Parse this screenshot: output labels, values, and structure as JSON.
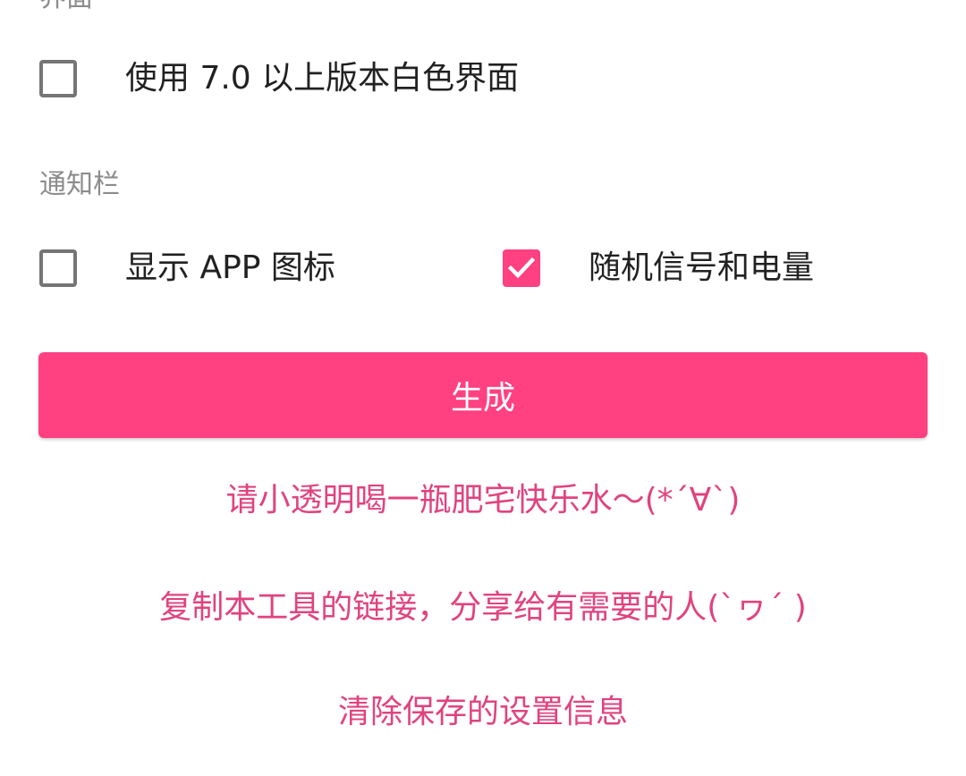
{
  "sections": {
    "interface": {
      "title": "界面",
      "white_ui": {
        "label": "使用 7.0 以上版本白色界面",
        "checked": false
      }
    },
    "notification_bar": {
      "title": "通知栏",
      "show_app_icon": {
        "label": "显示 APP 图标",
        "checked": false
      },
      "random_signal_battery": {
        "label": "随机信号和电量",
        "checked": true
      }
    }
  },
  "generate_button": {
    "label": "生成"
  },
  "links": {
    "donate": "请小透明喝一瓶肥宅快乐水～(*´∀`)",
    "share": "复制本工具的链接，分享给有需要的人(`ヮ´ )",
    "clear_settings": "清除保存的设置信息"
  },
  "colors": {
    "accent": "#ff4081",
    "link": "#e0437f",
    "checkbox_border": "#757575",
    "section_title": "#8c8c8c",
    "label_text": "#212121"
  },
  "icons": {
    "checkmark": "checkmark-icon"
  }
}
